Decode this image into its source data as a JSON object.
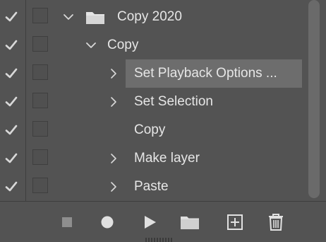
{
  "rows": [
    {
      "label": "Copy 2020",
      "checked": true,
      "indent": 0,
      "expanded": true,
      "chevron": "chevron-down",
      "icon": "folder-icon",
      "selected": false
    },
    {
      "label": "Copy",
      "checked": true,
      "indent": 1,
      "expanded": true,
      "chevron": "chevron-down",
      "selected": false
    },
    {
      "label": "Set Playback Options ...",
      "checked": true,
      "indent": 2,
      "chevron": "chevron-right",
      "selected": true
    },
    {
      "label": "Set Selection",
      "checked": true,
      "indent": 2,
      "chevron": "chevron-right",
      "selected": false
    },
    {
      "label": "Copy",
      "checked": true,
      "indent": 2,
      "chevron": null,
      "selected": false
    },
    {
      "label": "Make layer",
      "checked": true,
      "indent": 2,
      "chevron": "chevron-right",
      "selected": false
    },
    {
      "label": "Paste",
      "checked": true,
      "indent": 2,
      "chevron": "chevron-right",
      "selected": false
    }
  ],
  "toolbar": {
    "buttons": [
      "stop-icon",
      "record-icon",
      "play-icon",
      "new-set-folder-icon",
      "new-action-icon",
      "delete-icon"
    ]
  },
  "colors": {
    "background": "#535353",
    "selected_row": "#6d6d6d",
    "text": "#e6e6e6",
    "icon": "#d8d8d8",
    "stop_icon": "#8e8e8e"
  }
}
